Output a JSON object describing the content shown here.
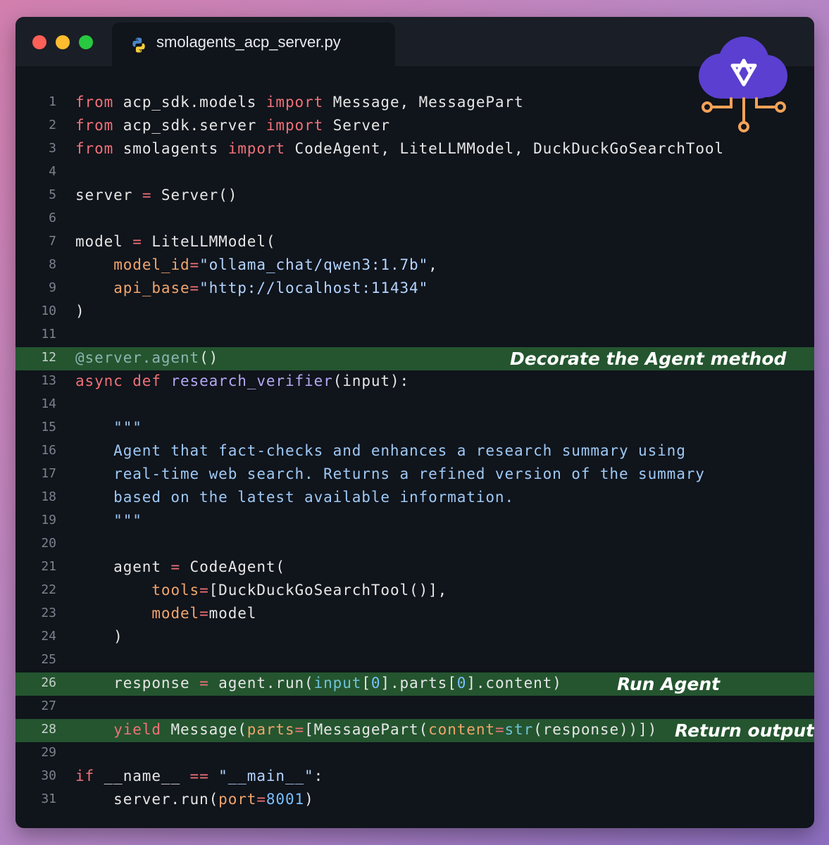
{
  "window": {
    "controls": [
      "close",
      "minimize",
      "maximize"
    ],
    "tab": {
      "filename": "smolagents_acp_server.py",
      "icon": "python-icon"
    },
    "logo_icon": "cloud-network-logo-icon"
  },
  "colors": {
    "background_gradient": [
      "#d27fae",
      "#8e6fc0"
    ],
    "editor_bg": "#10141b",
    "highlight_bg": "#24552f",
    "logo_cloud": "#5b3fd0",
    "logo_circuit": "#f4a259"
  },
  "code": {
    "lines": [
      {
        "n": "1",
        "text": "from acp_sdk.models import Message, MessagePart"
      },
      {
        "n": "2",
        "text": "from acp_sdk.server import Server"
      },
      {
        "n": "3",
        "text": "from smolagents import CodeAgent, LiteLLMModel, DuckDuckGoSearchTool"
      },
      {
        "n": "4",
        "text": ""
      },
      {
        "n": "5",
        "text": "server = Server()"
      },
      {
        "n": "6",
        "text": ""
      },
      {
        "n": "7",
        "text": "model = LiteLLMModel("
      },
      {
        "n": "8",
        "text": "    model_id=\"ollama_chat/qwen3:1.7b\","
      },
      {
        "n": "9",
        "text": "    api_base=\"http://localhost:11434\""
      },
      {
        "n": "10",
        "text": ")"
      },
      {
        "n": "11",
        "text": ""
      },
      {
        "n": "12",
        "text": "@server.agent()",
        "highlight": true,
        "note": "Decorate the Agent method"
      },
      {
        "n": "13",
        "text": "async def research_verifier(input):"
      },
      {
        "n": "14",
        "text": ""
      },
      {
        "n": "15",
        "text": "    \"\"\""
      },
      {
        "n": "16",
        "text": "    Agent that fact-checks and enhances a research summary using"
      },
      {
        "n": "17",
        "text": "    real-time web search. Returns a refined version of the summary"
      },
      {
        "n": "18",
        "text": "    based on the latest available information."
      },
      {
        "n": "19",
        "text": "    \"\"\""
      },
      {
        "n": "20",
        "text": ""
      },
      {
        "n": "21",
        "text": "    agent = CodeAgent("
      },
      {
        "n": "22",
        "text": "        tools=[DuckDuckGoSearchTool()],"
      },
      {
        "n": "23",
        "text": "        model=model"
      },
      {
        "n": "24",
        "text": "    )"
      },
      {
        "n": "25",
        "text": ""
      },
      {
        "n": "26",
        "text": "    response = agent.run(input[0].parts[0].content)",
        "highlight": true,
        "note": "Run Agent"
      },
      {
        "n": "27",
        "text": ""
      },
      {
        "n": "28",
        "text": "    yield Message(parts=[MessagePart(content=str(response))])",
        "highlight": true,
        "note": "Return output"
      },
      {
        "n": "29",
        "text": ""
      },
      {
        "n": "30",
        "text": "if __name__ == \"__main__\":"
      },
      {
        "n": "31",
        "text": "    server.run(port=8001)"
      }
    ]
  }
}
